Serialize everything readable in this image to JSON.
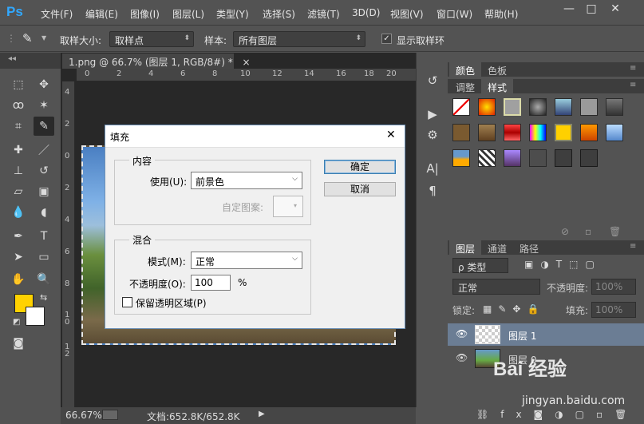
{
  "app": {
    "logo": "Ps"
  },
  "menu": [
    "文件(F)",
    "编辑(E)",
    "图像(I)",
    "图层(L)",
    "类型(Y)",
    "选择(S)",
    "滤镜(T)",
    "3D(D)",
    "视图(V)",
    "窗口(W)",
    "帮助(H)"
  ],
  "window_controls": {
    "minimize": "—",
    "maximize": "□",
    "close": "✕"
  },
  "options": {
    "sample_size_label": "取样大小:",
    "sample_size_value": "取样点",
    "sample_label": "样本:",
    "sample_value": "所有图层",
    "show_ring_label": "显示取样环",
    "show_ring_checked": true
  },
  "document": {
    "tab_title": "1.png @ 66.7% (图层 1, RGB/8#) *",
    "tab_close": "×",
    "ruler_h": [
      "0",
      "2",
      "4",
      "6",
      "8",
      "10",
      "12",
      "14",
      "16",
      "18",
      "20"
    ],
    "ruler_v": [
      "4",
      "2",
      "0",
      "2",
      "4",
      "6",
      "8",
      "1 0",
      "1 2"
    ]
  },
  "status": {
    "zoom": "66.67%",
    "doc_info": "文档:652.8K/652.8K",
    "arrow": "▶"
  },
  "colors": {
    "foreground": "#ffd200",
    "background": "#ffffff",
    "accent": "#31a8ff"
  },
  "right_panel": {
    "tabs_top": [
      "颜色",
      "色板"
    ],
    "tabs_mid": [
      "调整",
      "样式"
    ],
    "tabs_layers": [
      "图层",
      "通道",
      "路径"
    ],
    "layer_filter": "ρ 类型",
    "blend_mode": "正常",
    "opacity_label": "不透明度:",
    "opacity_value": "100%",
    "lock_label": "锁定:",
    "fill_label": "填充:",
    "fill_value": "100%",
    "layers": [
      {
        "name": "图层 1",
        "selected": true
      },
      {
        "name": "图层 0",
        "selected": false
      }
    ]
  },
  "fill_dialog": {
    "title": "填充",
    "close": "✕",
    "content_group": "内容",
    "use_label": "使用(U):",
    "use_value": "前景色",
    "custom_pattern_label": "自定图案:",
    "blend_group": "混合",
    "mode_label": "模式(M):",
    "mode_value": "正常",
    "opacity_label": "不透明度(O):",
    "opacity_value": "100",
    "opacity_unit": "%",
    "preserve_transparency_label": "保留透明区域(P)",
    "preserve_transparency_checked": false,
    "ok_button": "确定",
    "cancel_button": "取消"
  },
  "watermark": {
    "logo": "Bai 经验",
    "url": "jingyan.baidu.com"
  }
}
